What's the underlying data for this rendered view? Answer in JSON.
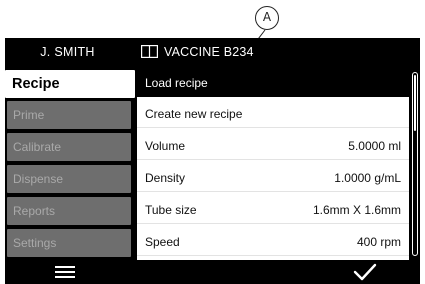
{
  "callout": {
    "label": "A"
  },
  "header": {
    "user": "J. SMITH",
    "bottle_icon": "book-icon",
    "bottle_name": "VACCINE B234"
  },
  "sidebar": {
    "items": [
      {
        "label": "Recipe",
        "active": true
      },
      {
        "label": "Prime",
        "active": false
      },
      {
        "label": "Calibrate",
        "active": false
      },
      {
        "label": "Dispense",
        "active": false
      },
      {
        "label": "Reports",
        "active": false
      },
      {
        "label": "Settings",
        "active": false
      }
    ]
  },
  "list": {
    "rows": [
      {
        "label": "Load recipe",
        "value": "",
        "selected": true
      },
      {
        "label": "Create new recipe",
        "value": "",
        "selected": false
      },
      {
        "label": "Volume",
        "value": "5.0000 ml",
        "selected": false
      },
      {
        "label": "Density",
        "value": "1.0000 g/mL",
        "selected": false
      },
      {
        "label": "Tube size",
        "value": "1.6mm X 1.6mm",
        "selected": false
      },
      {
        "label": "Speed",
        "value": "400 rpm",
        "selected": false
      }
    ]
  },
  "footer": {
    "left_icon": "menu-icon",
    "right_icon": "checkmark-icon"
  },
  "colors": {
    "screen_bg": "#000000",
    "inactive_tab": "#6e6e6e",
    "inactive_tab_text": "#a9a9a9"
  }
}
